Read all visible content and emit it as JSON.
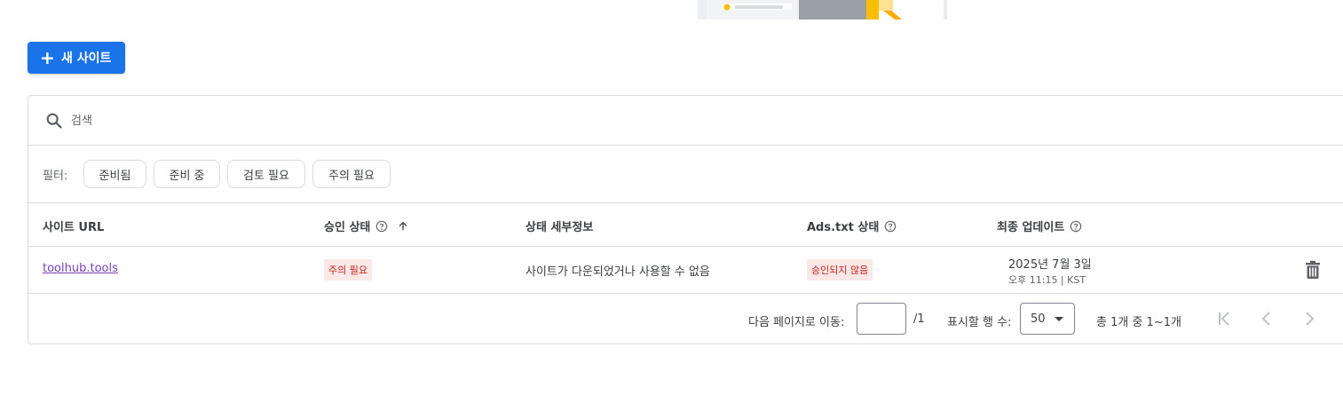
{
  "toolbar": {
    "add_site_label": "새 사이트",
    "add_icon": "plus-icon"
  },
  "search": {
    "placeholder": "검색",
    "icon": "search-icon"
  },
  "filters": {
    "label": "필터:",
    "chips": [
      "준비됨",
      "준비 중",
      "검토 필요",
      "주의 필요"
    ]
  },
  "table": {
    "columns": {
      "site_url": "사이트 URL",
      "approval_status": "승인 상태",
      "status_detail": "상태 세부정보",
      "ads_txt_status": "Ads.txt 상태",
      "last_updated": "최종 업데이트"
    },
    "rows": [
      {
        "site_url": "toolhub.tools",
        "approval_status": "주의 필요",
        "status_detail": "사이트가 다운되었거나 사용할 수 없음",
        "ads_txt_status": "승인되지 않음",
        "updated_date": "2025년 7월 3일",
        "updated_time": "오후 11:15 | KST"
      }
    ]
  },
  "pagination": {
    "goto_label": "다음 페이지로 이동:",
    "page_value": "",
    "page_total": "/1",
    "rows_label": "표시할 행 수:",
    "rows_value": "50",
    "range_text": "총 1개 중 1~1개"
  },
  "colors": {
    "primary": "#1a73e8",
    "warning_bg": "#fce8e6",
    "warning_text": "#c5221f",
    "link": "#7b3fbf"
  }
}
